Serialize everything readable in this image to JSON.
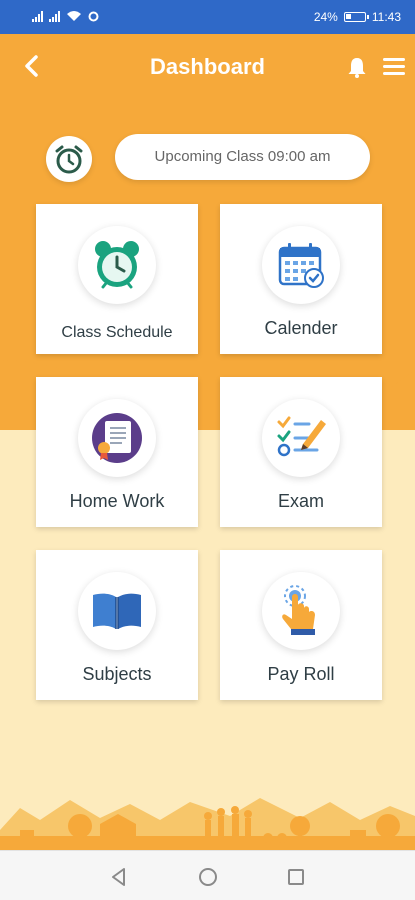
{
  "status_bar": {
    "battery": "24%",
    "time": "11:43"
  },
  "header": {
    "title": "Dashboard"
  },
  "upcoming": {
    "text": "Upcoming Class 09:00 am"
  },
  "tiles": [
    {
      "label": "Class Schedule",
      "icon": "alarm-clock-icon"
    },
    {
      "label": "Calender",
      "icon": "calendar-icon"
    },
    {
      "label": "Home Work",
      "icon": "homework-document-icon"
    },
    {
      "label": "Exam",
      "icon": "exam-checklist-icon"
    },
    {
      "label": "Subjects",
      "icon": "open-book-icon"
    },
    {
      "label": "Pay Roll",
      "icon": "tap-hand-icon"
    }
  ],
  "colors": {
    "status_bar": "#2f69c8",
    "accent": "#f6a93a",
    "background": "#fdebbd",
    "teal": "#1aa37f",
    "blue": "#2f73c8"
  },
  "nav": {
    "icons": [
      "back-triangle-icon",
      "home-circle-icon",
      "recents-square-icon"
    ]
  }
}
